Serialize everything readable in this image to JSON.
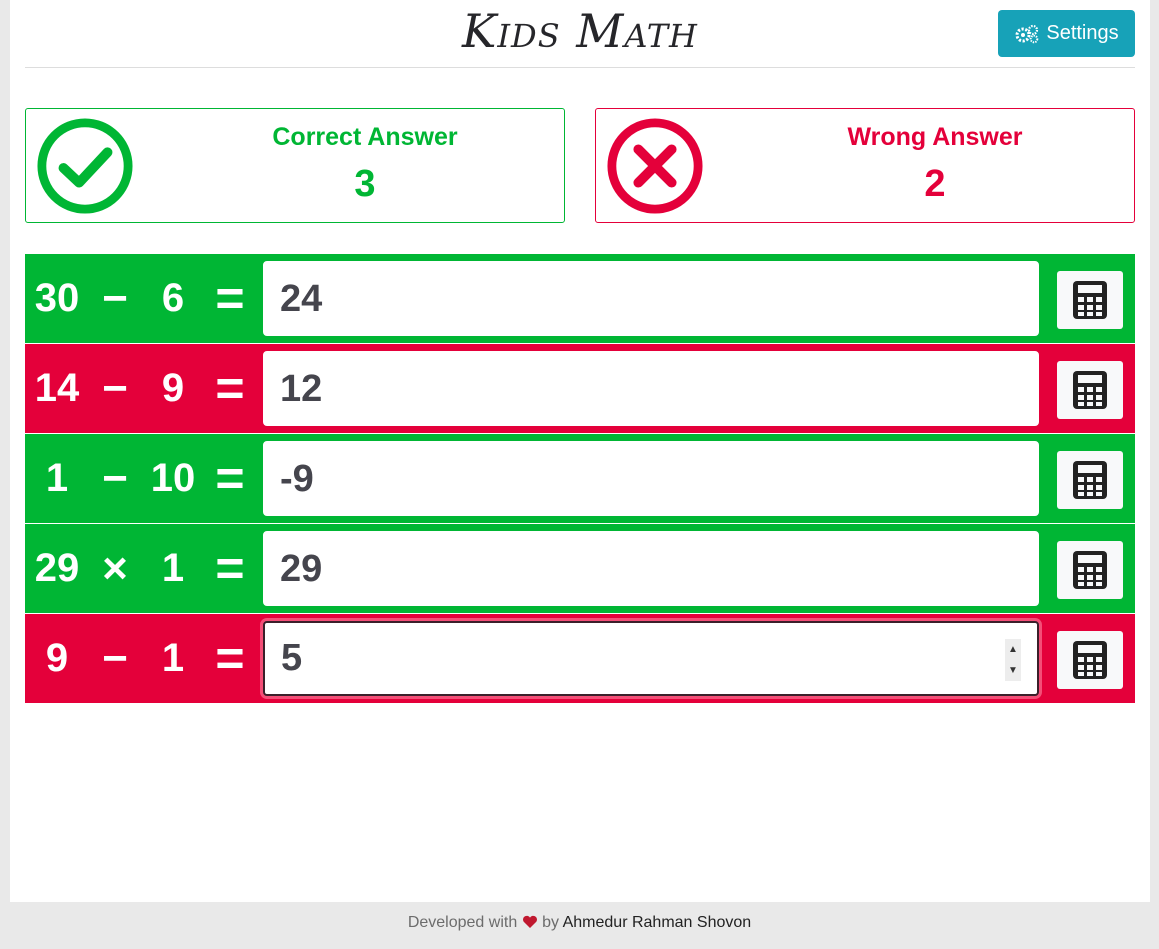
{
  "app": {
    "title": "Kids Math",
    "settings_label": "Settings"
  },
  "score": {
    "correct_label": "Correct Answer",
    "correct_count": "3",
    "wrong_label": "Wrong Answer",
    "wrong_count": "2"
  },
  "problems": [
    {
      "a": "30",
      "op": "−",
      "b": "6",
      "eq": "=",
      "answer": "24",
      "status": "correct"
    },
    {
      "a": "14",
      "op": "−",
      "b": "9",
      "eq": "=",
      "answer": "12",
      "status": "wrong"
    },
    {
      "a": "1",
      "op": "−",
      "b": "10",
      "eq": "=",
      "answer": "-9",
      "status": "correct"
    },
    {
      "a": "29",
      "op": "×",
      "b": "1",
      "eq": "=",
      "answer": "29",
      "status": "correct"
    },
    {
      "a": "9",
      "op": "−",
      "b": "1",
      "eq": "=",
      "answer": "5",
      "status": "wrong"
    }
  ],
  "footer": {
    "prefix": "Developed with",
    "by": "by",
    "author": "Ahmedur Rahman Shovon"
  },
  "colors": {
    "correct": "#00b634",
    "wrong": "#e4003a",
    "settings": "#17a2b8"
  },
  "icons": {
    "settings": "gears-icon",
    "correct": "check-circle-icon",
    "wrong": "x-circle-icon",
    "calculator": "calculator-icon",
    "footer": "heart-icon"
  }
}
